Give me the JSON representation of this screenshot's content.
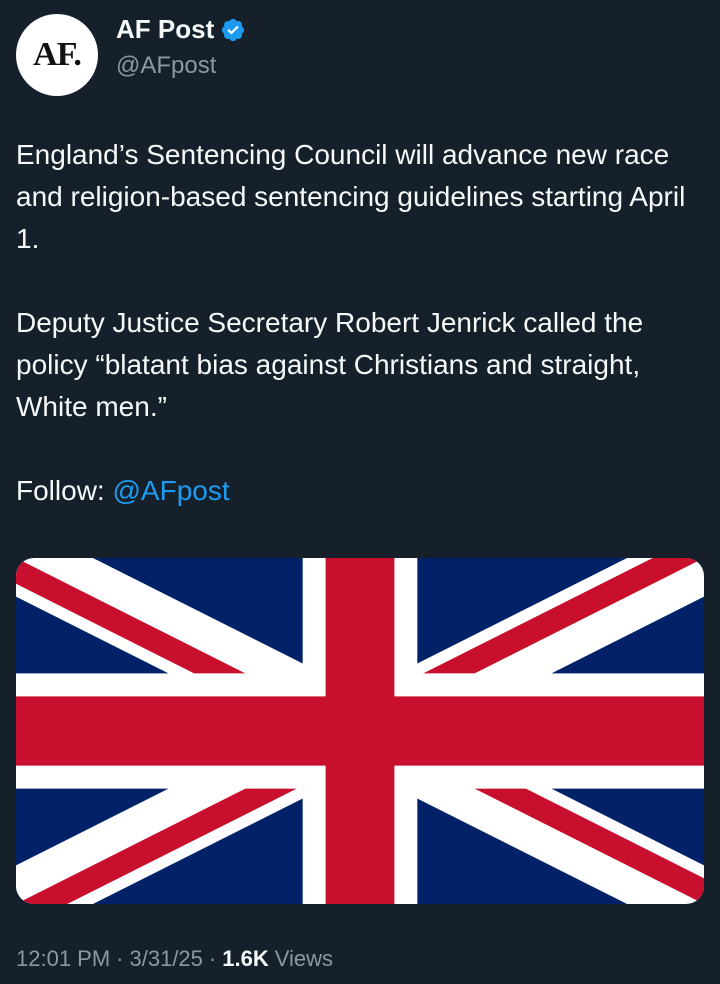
{
  "author": {
    "avatar_text": "AF.",
    "display_name": "AF Post",
    "handle": "@AFpost",
    "verified": true
  },
  "post": {
    "paragraph_1": "England’s Sentencing Council will advance new race and religion-based sentencing guidelines starting April 1.",
    "paragraph_2": "Deputy Justice Secretary Robert Jenrick called the policy “blatant bias against Christians and straight, White men.”",
    "follow_label": "Follow:",
    "follow_mention": "@AFpost",
    "media": {
      "icon": "union-jack-flag",
      "colors": {
        "blue": "#012169",
        "red": "#c8102e",
        "white": "#ffffff"
      }
    }
  },
  "meta": {
    "time": "12:01 PM",
    "separator": "·",
    "date": "3/31/25",
    "views_count": "1.6K",
    "views_label": "Views"
  },
  "colors": {
    "background": "#15202b",
    "text": "#f7f9f9",
    "secondary": "#8b98a5",
    "link": "#1d9bf0",
    "verified": "#1d9bf0"
  }
}
